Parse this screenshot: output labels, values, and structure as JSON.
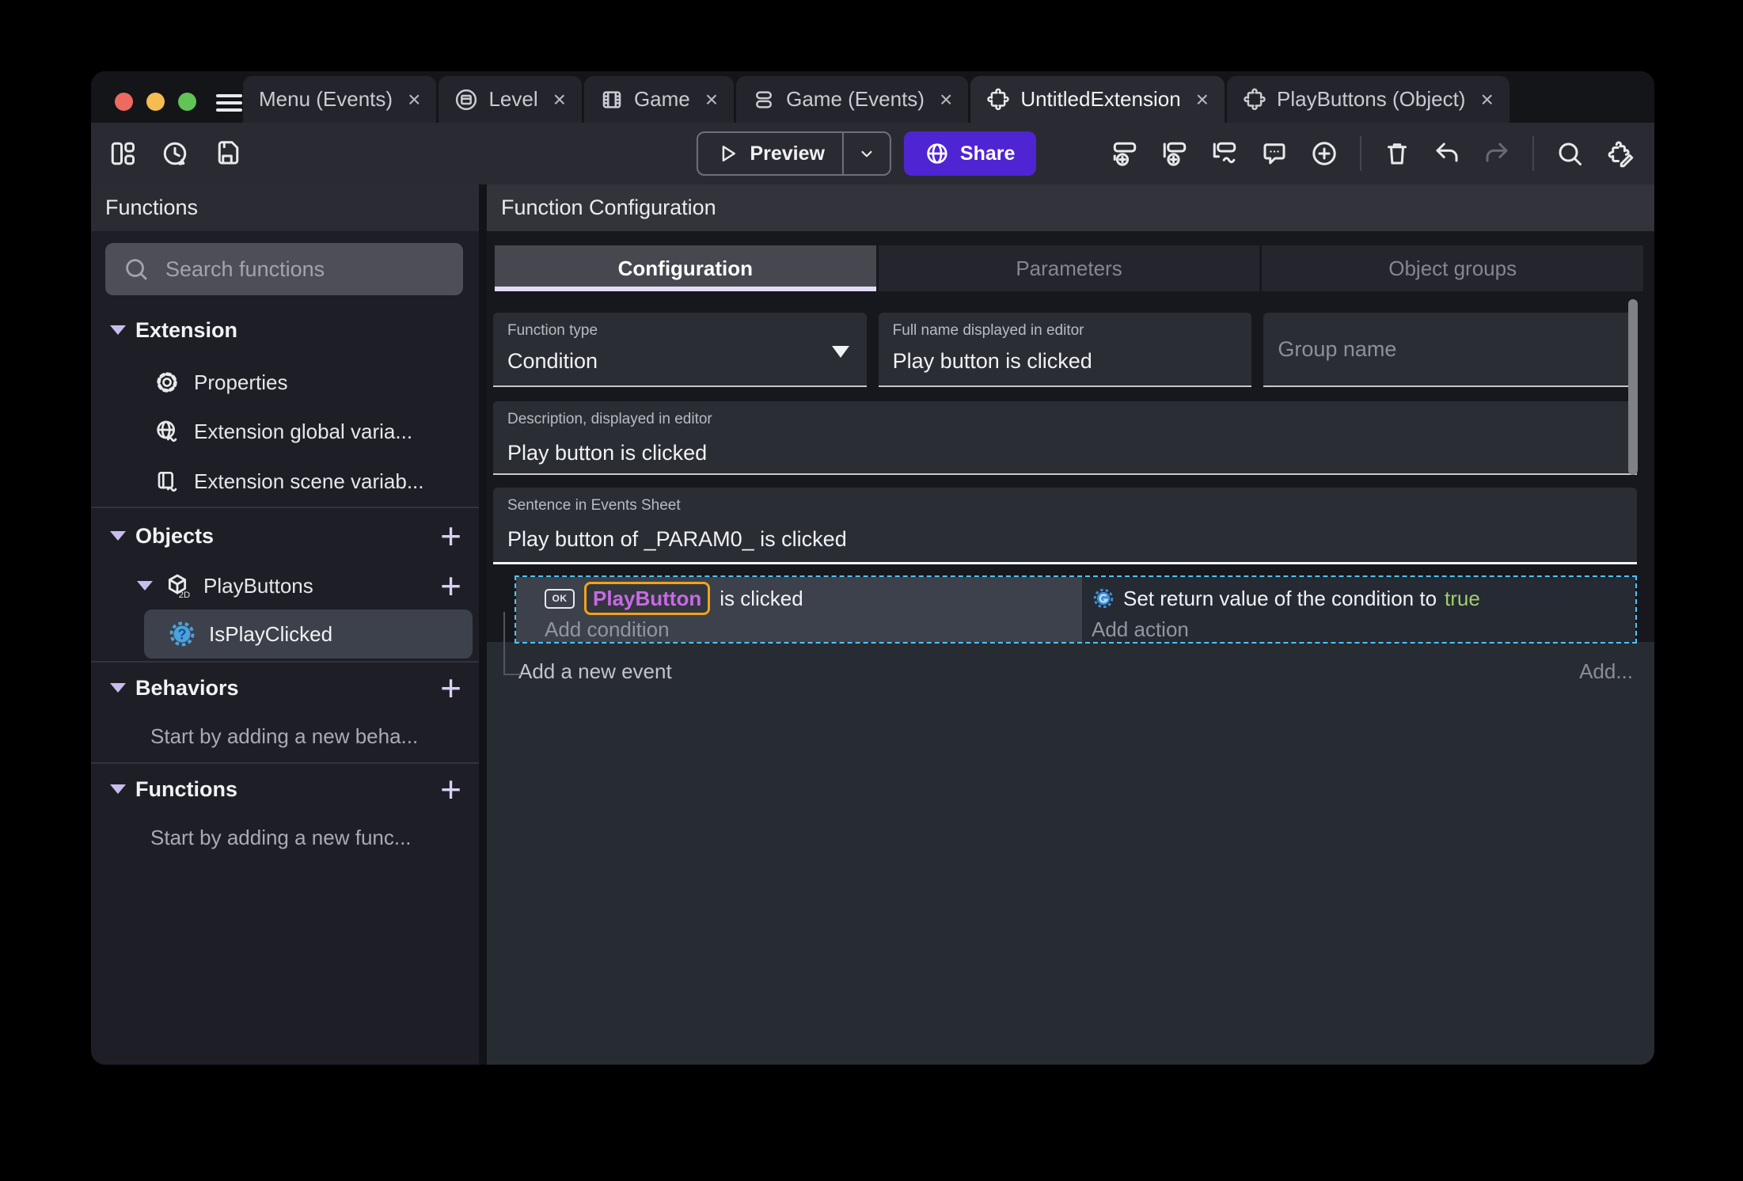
{
  "window": {
    "tabs": [
      {
        "label": "Menu (Events)",
        "active": false
      },
      {
        "label": "Level",
        "active": false
      },
      {
        "label": "Game",
        "active": false
      },
      {
        "label": "Game (Events)",
        "active": false
      },
      {
        "label": "UntitledExtension",
        "active": true
      },
      {
        "label": "PlayButtons (Object)",
        "active": false
      }
    ],
    "close_glyph": "×",
    "toolbar": {
      "preview": "Preview",
      "share": "Share"
    }
  },
  "sidebar": {
    "title": "Functions",
    "search_placeholder": "Search functions",
    "extension_header": "Extension",
    "extension_items": [
      "Properties",
      "Extension global varia...",
      "Extension scene variab..."
    ],
    "objects_header": "Objects",
    "object_group": "PlayButtons",
    "object_function": "IsPlayClicked",
    "behaviors_header": "Behaviors",
    "behaviors_empty": "Start by adding a new beha...",
    "functions_header": "Functions",
    "functions_empty": "Start by adding a new func...",
    "add_glyph": "+"
  },
  "main": {
    "title": "Function Configuration",
    "tabs": [
      "Configuration",
      "Parameters",
      "Object groups"
    ],
    "function_type_label": "Function type",
    "function_type_value": "Condition",
    "full_name_label": "Full name displayed in editor",
    "full_name_value": "Play button is clicked",
    "group_name_placeholder": "Group name",
    "description_label": "Description, displayed in editor",
    "description_value": "Play button is clicked",
    "sentence_label": "Sentence in Events Sheet",
    "sentence_value": "Play button of _PARAM0_ is clicked",
    "events": {
      "condition_icon_text": "OK",
      "condition_object": "PlayButton",
      "condition_suffix": "is clicked",
      "add_condition": "Add condition",
      "action_text": "Set return value of the condition to",
      "action_value": "true",
      "add_action": "Add action",
      "add_new_event": "Add a new event",
      "add_more": "Add..."
    }
  },
  "colors": {
    "accent_purple": "#4F24D3",
    "selection_dashed": "#4FC3F7",
    "chip_border": "#F0A31B",
    "chip_text": "#C76AE3",
    "true_green": "#A3CC6E",
    "traffic_red": "#EE6A5F",
    "traffic_yellow": "#F5BD4F",
    "traffic_green": "#61C454"
  }
}
